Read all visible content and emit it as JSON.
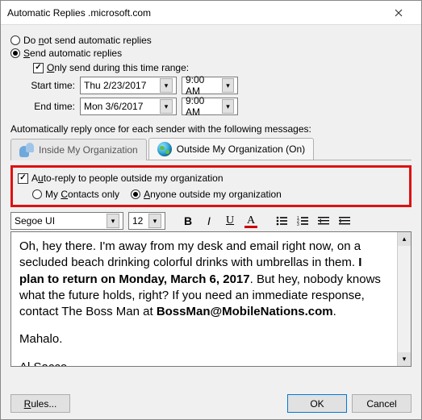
{
  "window": {
    "title": "Automatic Replies          .microsoft.com"
  },
  "mode": {
    "do_not_send": "Do not send automatic replies",
    "send": "Send automatic replies"
  },
  "range": {
    "only_send": "Only send during this time range:",
    "start_label": "Start time:",
    "end_label": "End time:",
    "start_date": "Thu 2/23/2017",
    "start_time": "9:00 AM",
    "end_date": "Mon 3/6/2017",
    "end_time": "9:00 AM"
  },
  "auto_label": "Automatically reply once for each sender with the following messages:",
  "tabs": {
    "inside": "Inside My Organization",
    "outside": "Outside My Organization (On)"
  },
  "outside_opts": {
    "auto_reply": "Auto-reply to people outside my organization",
    "contacts_only": "My Contacts only",
    "anyone": "Anyone outside my organization"
  },
  "format": {
    "font": "Segoe UI",
    "size": "12"
  },
  "message": {
    "p1a": "Oh, hey there. I'm away from my desk and email right now, on a secluded beach drinking colorful drinks with umbrellas in them. ",
    "p1b": "I plan to return on Monday, March 6, 2017",
    "p1c": ". But hey, nobody knows what the future holds, right? If you need an immediate response, contact The Boss Man at ",
    "p1d": "BossMan@MobileNations.com",
    "p1e": ".",
    "p2": "Mahalo.",
    "p3": "Al Sacco"
  },
  "buttons": {
    "rules": "Rules...",
    "ok": "OK",
    "cancel": "Cancel"
  }
}
